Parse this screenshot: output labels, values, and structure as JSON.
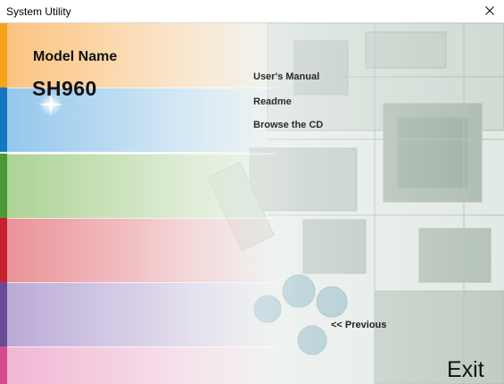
{
  "window": {
    "title": "System Utility",
    "close_glyph": "×"
  },
  "model": {
    "label": "Model Name",
    "value": "SH960"
  },
  "menu": {
    "items": [
      {
        "label": "User's Manual",
        "icon": "none"
      },
      {
        "label": "Readme",
        "icon": "none"
      },
      {
        "label": "Browse the CD",
        "icon": "none"
      }
    ]
  },
  "navigation": {
    "previous_label": "<< Previous",
    "exit_label": "Exit"
  },
  "strips": [
    {
      "name": "orange",
      "tab_color": "#f7a21b",
      "fade_color": "#fbc07a"
    },
    {
      "name": "blue",
      "tab_color": "#1576c2",
      "fade_color": "#8ec4ea"
    },
    {
      "name": "green",
      "tab_color": "#4a9a36",
      "fade_color": "#a8d08f"
    },
    {
      "name": "red",
      "tab_color": "#c8202f",
      "fade_color": "#e88c92"
    },
    {
      "name": "purple",
      "tab_color": "#6a4a96",
      "fade_color": "#b7a6d4"
    },
    {
      "name": "pink",
      "tab_color": "#d64b8f",
      "fade_color": "#f0b2d0"
    }
  ]
}
